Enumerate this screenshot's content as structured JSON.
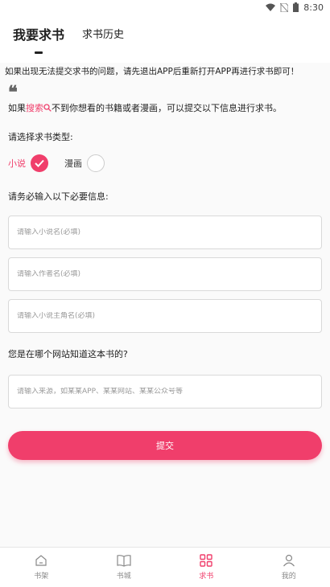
{
  "status_bar": {
    "time": "8:30"
  },
  "header": {
    "tabs": [
      {
        "label": "我要求书",
        "active": true
      },
      {
        "label": "求书历史",
        "active": false
      }
    ]
  },
  "notice": "如果出现无法提交求书的问题，请先退出APP后重新打开APP再进行求书即可！",
  "quote_mark": "❝",
  "intro": {
    "prefix": "如果",
    "highlight": "搜索",
    "suffix": "不到你想看的书籍或者漫画，可以提交以下信息进行求书。"
  },
  "type_section": {
    "label": "请选择求书类型:",
    "options": [
      {
        "label": "小说",
        "checked": true
      },
      {
        "label": "漫画",
        "checked": false
      }
    ]
  },
  "required_section": {
    "label": "请务必输入以下必要信息:",
    "fields": [
      {
        "placeholder": "请输入小说名(必填)",
        "value": ""
      },
      {
        "placeholder": "请输入作者名(必填)",
        "value": ""
      },
      {
        "placeholder": "请输入小说主角名(必填)",
        "value": ""
      }
    ]
  },
  "source_section": {
    "label": "您是在哪个网站知道这本书的?",
    "placeholder": "请输入来源，如某某APP、某某网站、某某公众号等",
    "value": ""
  },
  "submit_label": "提交",
  "bottom_nav": [
    {
      "label": "书架",
      "icon": "home-icon",
      "active": false
    },
    {
      "label": "书城",
      "icon": "book-icon",
      "active": false
    },
    {
      "label": "求书",
      "icon": "grid-icon",
      "active": true
    },
    {
      "label": "我的",
      "icon": "user-icon",
      "active": false
    }
  ],
  "colors": {
    "accent": "#f03e6b",
    "text": "#222222",
    "placeholder": "#999999",
    "background": "#fafafa"
  }
}
